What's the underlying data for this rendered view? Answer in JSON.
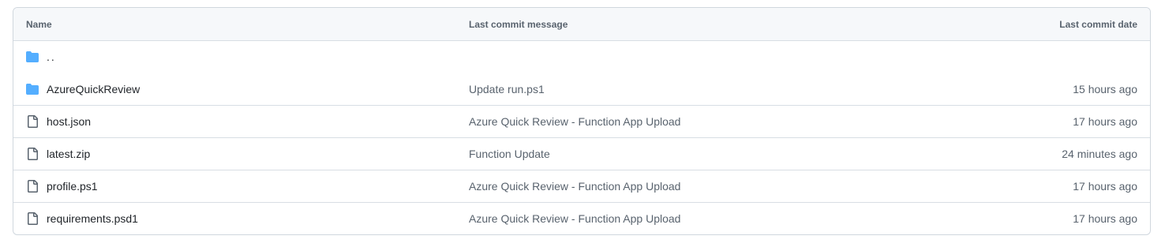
{
  "table": {
    "headers": {
      "name": "Name",
      "message": "Last commit message",
      "date": "Last commit date"
    },
    "updir": {
      "label": "..",
      "icon": "folder-icon"
    },
    "rows": [
      {
        "name": "AzureQuickReview",
        "type": "folder",
        "icon": "folder-icon",
        "message": "Update run.ps1",
        "date": "15 hours ago"
      },
      {
        "name": "host.json",
        "type": "file",
        "icon": "file-icon",
        "message": "Azure Quick Review - Function App Upload",
        "date": "17 hours ago"
      },
      {
        "name": "latest.zip",
        "type": "file",
        "icon": "file-icon",
        "message": "Function Update",
        "date": "24 minutes ago"
      },
      {
        "name": "profile.ps1",
        "type": "file",
        "icon": "file-icon",
        "message": "Azure Quick Review - Function App Upload",
        "date": "17 hours ago"
      },
      {
        "name": "requirements.psd1",
        "type": "file",
        "icon": "file-icon",
        "message": "Azure Quick Review - Function App Upload",
        "date": "17 hours ago"
      }
    ]
  },
  "colors": {
    "folder": "#54aeff",
    "file_icon": "#59636e",
    "border": "#d0d7de",
    "header_bg": "#f6f8fa"
  }
}
